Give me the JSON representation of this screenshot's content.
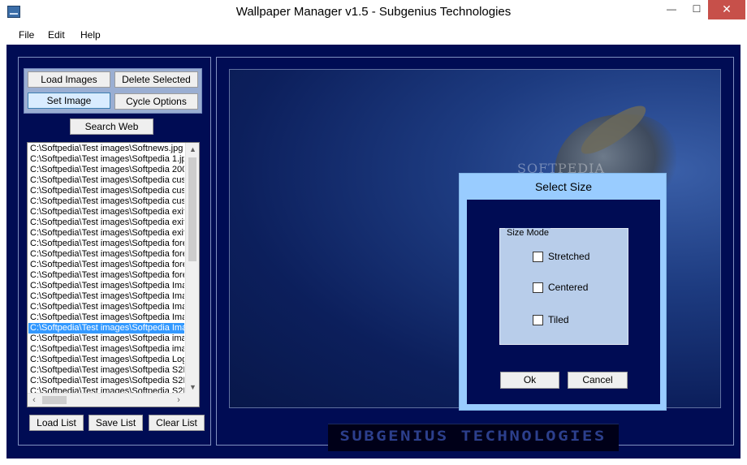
{
  "window": {
    "title": "Wallpaper Manager v1.5 - Subgenius Technologies",
    "minimize_glyph": "—",
    "maximize_glyph": "☐",
    "close_glyph": "✕"
  },
  "menu": {
    "file": "File",
    "edit": "Edit",
    "help": "Help"
  },
  "left_panel": {
    "load_images": "Load Images",
    "delete_selected": "Delete Selected",
    "set_image": "Set Image",
    "cycle_options": "Cycle Options",
    "search_web": "Search Web",
    "load_list": "Load List",
    "save_list": "Save List",
    "clear_list": "Clear List"
  },
  "file_list": [
    "C:\\Softpedia\\Test images\\Softnews.jpg",
    "C:\\Softpedia\\Test images\\Softpedia 1.jpg",
    "C:\\Softpedia\\Test images\\Softpedia 200",
    "C:\\Softpedia\\Test images\\Softpedia cus",
    "C:\\Softpedia\\Test images\\Softpedia cus",
    "C:\\Softpedia\\Test images\\Softpedia cus",
    "C:\\Softpedia\\Test images\\Softpedia exif",
    "C:\\Softpedia\\Test images\\Softpedia exif",
    "C:\\Softpedia\\Test images\\Softpedia exif",
    "C:\\Softpedia\\Test images\\Softpedia fore",
    "C:\\Softpedia\\Test images\\Softpedia fore",
    "C:\\Softpedia\\Test images\\Softpedia fore",
    "C:\\Softpedia\\Test images\\Softpedia fore",
    "C:\\Softpedia\\Test images\\Softpedia Ima",
    "C:\\Softpedia\\Test images\\Softpedia Ima",
    "C:\\Softpedia\\Test images\\Softpedia Ima",
    "C:\\Softpedia\\Test images\\Softpedia Ima",
    "C:\\Softpedia\\Test images\\Softpedia Ima",
    "C:\\Softpedia\\Test images\\Softpedia ima",
    "C:\\Softpedia\\Test images\\Softpedia ima",
    "C:\\Softpedia\\Test images\\Softpedia Log",
    "C:\\Softpedia\\Test images\\Softpedia S2I",
    "C:\\Softpedia\\Test images\\Softpedia S2I",
    "C:\\Softpedia\\Test images\\Softpedia S2I"
  ],
  "file_list_selected_index": 17,
  "preview": {
    "watermark": "SOFTPEDIA",
    "logo": "SUBGENIUS TECHNOLOGIES"
  },
  "dialog": {
    "title": "Select Size",
    "group_label": "Size Mode",
    "stretched": "Stretched",
    "centered": "Centered",
    "tiled": "Tiled",
    "ok": "Ok",
    "cancel": "Cancel"
  },
  "colors": {
    "client_background": "#000c54",
    "dialog_frame": "#99ccff",
    "selection": "#3399ff"
  }
}
